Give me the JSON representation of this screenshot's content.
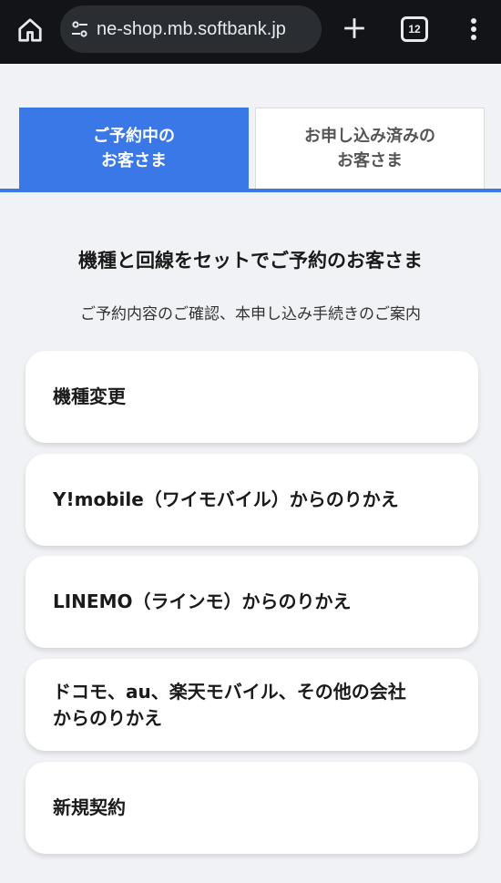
{
  "browser": {
    "url": "ne-shop.mb.softbank.jp",
    "tab_count": "12"
  },
  "tabs": [
    {
      "line1": "ご予約中の",
      "line2": "お客さま"
    },
    {
      "line1": "お申し込み済みの",
      "line2": "お客さま"
    }
  ],
  "section": {
    "title": "機種と回線をセットでご予約のお客さま",
    "subtitle": "ご予約内容のご確認、本申し込み手続きのご案内"
  },
  "options": [
    {
      "line1": "機種変更",
      "line2": ""
    },
    {
      "line1": "Y!mobile（ワイモバイル）からのりかえ",
      "line2": ""
    },
    {
      "line1": "LINEMO（ラインモ）からのりかえ",
      "line2": ""
    },
    {
      "line1": "ドコモ、au、楽天モバイル、その他の会社",
      "line2": "からのりかえ"
    },
    {
      "line1": "新規契約",
      "line2": ""
    }
  ],
  "colors": {
    "accent": "#3b78e7",
    "page_bg": "#f1f2f5",
    "chrome_bg": "#121417"
  }
}
